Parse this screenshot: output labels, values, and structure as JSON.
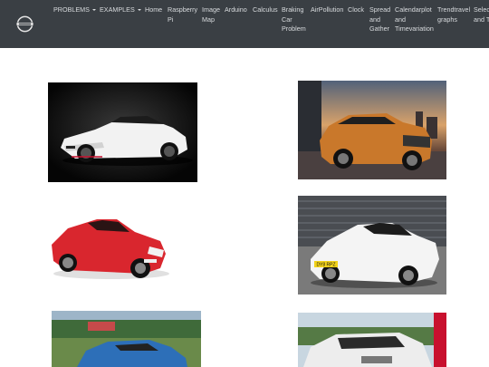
{
  "nav": {
    "items": [
      {
        "label": "PROBLEMS",
        "dropdown": true
      },
      {
        "label": "EXAMPLES",
        "dropdown": true
      },
      {
        "label": "Home"
      },
      {
        "label": "Raspberry Pi"
      },
      {
        "label": "Image Map"
      },
      {
        "label": "Arduino"
      },
      {
        "label": "Calculus"
      },
      {
        "label": "Braking Car Problem"
      },
      {
        "label": "AirPollution"
      },
      {
        "label": "Clock"
      },
      {
        "label": "Spread and Gather"
      },
      {
        "label": "Calendarplot and Timevariation"
      },
      {
        "label": "Trendtravel graphs"
      },
      {
        "label": "Selection and Timing"
      }
    ]
  },
  "colors": {
    "navbar": "#3a3f44",
    "nav_text": "#d8dbde",
    "background": "#ffffff"
  },
  "gallery": {
    "images": [
      {
        "icon": "car-gtr-white-photo"
      },
      {
        "icon": "car-xtrail-orange-photo"
      },
      {
        "icon": "car-370z-red-photo"
      },
      {
        "icon": "car-370z-white-photo"
      },
      {
        "icon": "car-qashqai-blue-photo"
      },
      {
        "icon": "car-navara-white-photo"
      }
    ],
    "plates": [
      "DY8 RPZ"
    ]
  }
}
